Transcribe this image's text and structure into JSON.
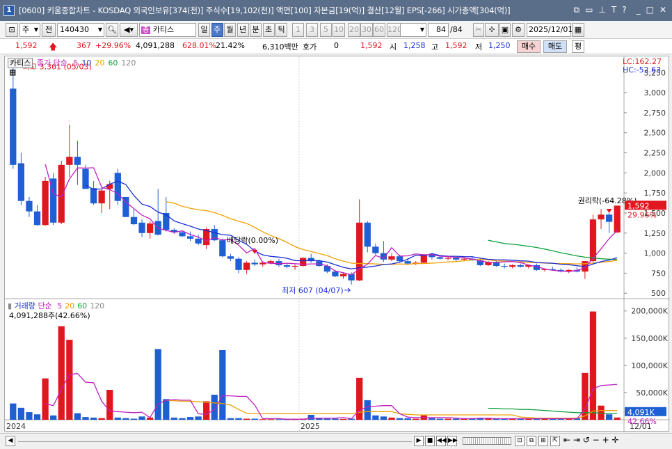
{
  "window": {
    "number": "1",
    "title": "[0600] 키움종합차트 - KOSDAQ 외국인보유[374(천)] 주식수[19,102(천)] 액면[100] 자본금[19(억)] 결산[12월] EPS[-266] 시가총액[304(억)]",
    "icons": [
      "restore-icon",
      "float-icon",
      "pin-icon",
      "text-icon",
      "help-icon",
      "minimize-icon",
      "maximize-icon",
      "close-icon"
    ]
  },
  "toolbar": {
    "period_label": "주",
    "prev_label": "전",
    "code": "140430",
    "stock_badge": "종",
    "stock_name": "카티스",
    "periods": [
      "일",
      "주",
      "월",
      "년",
      "분",
      "초",
      "틱"
    ],
    "active_period": "주",
    "intervals": [
      "1",
      "3",
      "5",
      "10",
      "20",
      "30",
      "60",
      "120"
    ],
    "count": "84",
    "count_total": "/84",
    "date": "2025/12/01"
  },
  "quote": {
    "price": "1,592",
    "change": "367",
    "change_pct": "+29.96%",
    "volume": "4,091,288",
    "volume_ratio": "628.01%",
    "turnover": "21.42%",
    "amount": "6,310백만",
    "hoga_label": "호가",
    "hoga_value": "0",
    "hoga_price": "1,592",
    "open_label": "시",
    "open": "1,258",
    "high_label": "고",
    "high": "1,592",
    "low_label": "저",
    "low": "1,250",
    "buy_label": "매수",
    "sell_label": "매도",
    "avg_label": "평"
  },
  "price_panel": {
    "stock_tag": "카티스",
    "legend_prefix": "종가 단순",
    "ma_periods": [
      "5",
      "10",
      "20",
      "60",
      "120"
    ],
    "ma_colors": [
      "#c020c0",
      "#1a2ed6",
      "#f0a000",
      "#10a040",
      "#888888"
    ],
    "lc_label": "LC:162.27",
    "hc_label": "HC:-52.63",
    "high_note": "최고 3,361 (05/03)",
    "low_note": "최저 607 (04/07)",
    "dividend_note": "배당락(0.00%)",
    "rights_note": "권리락(-64.28%)",
    "price_tag": "1,592",
    "pct_tag": "29.96%"
  },
  "volume_panel": {
    "title": "거래량",
    "legend_prefix": "단순",
    "ma_periods": [
      "5",
      "20",
      "60",
      "120"
    ],
    "ma_colors": [
      "#c020c0",
      "#f0a000",
      "#10a040",
      "#888888"
    ],
    "value_label": "4,091,288주(42.66%)",
    "vol_tag": "4,091K",
    "pct_tag": "42.66%"
  },
  "x_axis": {
    "labels": [
      "2024",
      "2025"
    ],
    "end_label": "12/01"
  },
  "chart_data": {
    "type": "candlestick",
    "price_axis": {
      "ticks": [
        "500",
        "750",
        "1,000",
        "1,250",
        "1,500",
        "1,750",
        "2,000",
        "2,250",
        "2,500",
        "2,750",
        "3,000",
        "3,250"
      ],
      "range": [
        450,
        3400
      ]
    },
    "volume_axis": {
      "ticks": [
        "50,000K",
        "100,000K",
        "150,000K",
        "200,000K"
      ],
      "range": [
        0,
        215000
      ]
    },
    "candles": [
      {
        "o": 3050,
        "h": 3361,
        "l": 2050,
        "c": 2100
      },
      {
        "o": 2120,
        "h": 2250,
        "l": 1600,
        "c": 1650
      },
      {
        "o": 1650,
        "h": 1700,
        "l": 1450,
        "c": 1520
      },
      {
        "o": 1520,
        "h": 1600,
        "l": 1340,
        "c": 1350
      },
      {
        "o": 1350,
        "h": 1950,
        "l": 1340,
        "c": 1900
      },
      {
        "o": 1930,
        "h": 2000,
        "l": 1350,
        "c": 1380
      },
      {
        "o": 1380,
        "h": 2150,
        "l": 1360,
        "c": 2100
      },
      {
        "o": 2100,
        "h": 2600,
        "l": 1950,
        "c": 2200
      },
      {
        "o": 2200,
        "h": 2400,
        "l": 1850,
        "c": 2100
      },
      {
        "o": 2050,
        "h": 2100,
        "l": 1800,
        "c": 1800
      },
      {
        "o": 1810,
        "h": 1900,
        "l": 1600,
        "c": 1620
      },
      {
        "o": 1620,
        "h": 1800,
        "l": 1500,
        "c": 1780
      },
      {
        "o": 1800,
        "h": 1900,
        "l": 1550,
        "c": 1860
      },
      {
        "o": 2000,
        "h": 2050,
        "l": 1600,
        "c": 1650
      },
      {
        "o": 1700,
        "h": 1700,
        "l": 1450,
        "c": 1450
      },
      {
        "o": 1450,
        "h": 1550,
        "l": 1350,
        "c": 1360
      },
      {
        "o": 1380,
        "h": 1420,
        "l": 1200,
        "c": 1250
      },
      {
        "o": 1250,
        "h": 1400,
        "l": 1180,
        "c": 1370
      },
      {
        "o": 1400,
        "h": 1800,
        "l": 1220,
        "c": 1230
      },
      {
        "o": 1500,
        "h": 1700,
        "l": 1270,
        "c": 1290
      },
      {
        "o": 1290,
        "h": 1310,
        "l": 1240,
        "c": 1260
      },
      {
        "o": 1260,
        "h": 1280,
        "l": 1200,
        "c": 1210
      },
      {
        "o": 1210,
        "h": 1270,
        "l": 1150,
        "c": 1180
      },
      {
        "o": 1180,
        "h": 1230,
        "l": 1100,
        "c": 1120
      },
      {
        "o": 1100,
        "h": 1320,
        "l": 1050,
        "c": 1300
      },
      {
        "o": 1300,
        "h": 1350,
        "l": 1150,
        "c": 1160
      },
      {
        "o": 1160,
        "h": 1180,
        "l": 950,
        "c": 960
      },
      {
        "o": 960,
        "h": 990,
        "l": 900,
        "c": 930
      },
      {
        "o": 930,
        "h": 950,
        "l": 750,
        "c": 790
      },
      {
        "o": 790,
        "h": 900,
        "l": 740,
        "c": 880
      },
      {
        "o": 880,
        "h": 920,
        "l": 840,
        "c": 860
      },
      {
        "o": 860,
        "h": 900,
        "l": 830,
        "c": 880
      },
      {
        "o": 880,
        "h": 920,
        "l": 860,
        "c": 900
      },
      {
        "o": 900,
        "h": 930,
        "l": 830,
        "c": 850
      },
      {
        "o": 850,
        "h": 870,
        "l": 810,
        "c": 830
      },
      {
        "o": 830,
        "h": 860,
        "l": 790,
        "c": 840
      },
      {
        "o": 840,
        "h": 950,
        "l": 830,
        "c": 940
      },
      {
        "o": 940,
        "h": 990,
        "l": 880,
        "c": 900
      },
      {
        "o": 900,
        "h": 920,
        "l": 830,
        "c": 840
      },
      {
        "o": 840,
        "h": 860,
        "l": 750,
        "c": 770
      },
      {
        "o": 770,
        "h": 790,
        "l": 700,
        "c": 710
      },
      {
        "o": 710,
        "h": 760,
        "l": 680,
        "c": 740
      },
      {
        "o": 740,
        "h": 760,
        "l": 607,
        "c": 660
      },
      {
        "o": 660,
        "h": 1670,
        "l": 650,
        "c": 1380
      },
      {
        "o": 1380,
        "h": 1400,
        "l": 1010,
        "c": 1080
      },
      {
        "o": 1080,
        "h": 1120,
        "l": 980,
        "c": 1000
      },
      {
        "o": 1000,
        "h": 1150,
        "l": 890,
        "c": 920
      },
      {
        "o": 920,
        "h": 1000,
        "l": 900,
        "c": 960
      },
      {
        "o": 960,
        "h": 980,
        "l": 890,
        "c": 900
      },
      {
        "o": 900,
        "h": 940,
        "l": 850,
        "c": 870
      },
      {
        "o": 870,
        "h": 900,
        "l": 850,
        "c": 880
      },
      {
        "o": 880,
        "h": 990,
        "l": 870,
        "c": 980
      },
      {
        "o": 980,
        "h": 1000,
        "l": 920,
        "c": 950
      },
      {
        "o": 950,
        "h": 970,
        "l": 920,
        "c": 930
      },
      {
        "o": 930,
        "h": 960,
        "l": 910,
        "c": 940
      },
      {
        "o": 940,
        "h": 960,
        "l": 900,
        "c": 920
      },
      {
        "o": 920,
        "h": 950,
        "l": 900,
        "c": 930
      },
      {
        "o": 930,
        "h": 950,
        "l": 900,
        "c": 910
      },
      {
        "o": 910,
        "h": 920,
        "l": 840,
        "c": 850
      },
      {
        "o": 850,
        "h": 900,
        "l": 840,
        "c": 890
      },
      {
        "o": 890,
        "h": 900,
        "l": 830,
        "c": 840
      },
      {
        "o": 840,
        "h": 870,
        "l": 810,
        "c": 830
      },
      {
        "o": 830,
        "h": 860,
        "l": 810,
        "c": 850
      },
      {
        "o": 850,
        "h": 870,
        "l": 820,
        "c": 830
      },
      {
        "o": 830,
        "h": 860,
        "l": 810,
        "c": 850
      },
      {
        "o": 850,
        "h": 870,
        "l": 780,
        "c": 790
      },
      {
        "o": 790,
        "h": 810,
        "l": 770,
        "c": 800
      },
      {
        "o": 800,
        "h": 830,
        "l": 780,
        "c": 790
      },
      {
        "o": 790,
        "h": 810,
        "l": 760,
        "c": 770
      },
      {
        "o": 770,
        "h": 800,
        "l": 750,
        "c": 790
      },
      {
        "o": 790,
        "h": 820,
        "l": 760,
        "c": 770
      },
      {
        "o": 770,
        "h": 900,
        "l": 680,
        "c": 900
      },
      {
        "o": 900,
        "h": 1480,
        "l": 880,
        "c": 1420
      },
      {
        "o": 1420,
        "h": 1550,
        "l": 1300,
        "c": 1480
      },
      {
        "o": 1480,
        "h": 1500,
        "l": 1250,
        "c": 1390
      },
      {
        "o": 1258,
        "h": 1592,
        "l": 1250,
        "c": 1592
      }
    ],
    "volumes": [
      30000,
      22000,
      14000,
      10000,
      76000,
      8000,
      172000,
      147000,
      12000,
      5000,
      4000,
      3000,
      55000,
      4000,
      3000,
      2000,
      6000,
      4000,
      130000,
      38000,
      4000,
      3000,
      5000,
      6000,
      34000,
      46000,
      128000,
      3000,
      3000,
      2000,
      2000,
      1000,
      1000,
      1000,
      1000,
      1000,
      2000,
      9000,
      3000,
      2000,
      2000,
      1500,
      2000,
      77000,
      36000,
      8000,
      6000,
      4000,
      3000,
      3000,
      2000,
      8000,
      3000,
      2000,
      2000,
      2000,
      2000,
      3000,
      3000,
      2000,
      2000,
      2000,
      2000,
      2000,
      2000,
      2000,
      2000,
      2000,
      2000,
      2000,
      3000,
      86000,
      199000,
      26000,
      10000,
      4091
    ],
    "ma5": [
      null,
      null,
      null,
      null,
      2106,
      1740,
      1700,
      1923,
      2062,
      2060,
      2064,
      1820,
      1792,
      1742,
      1636,
      1554,
      1473,
      1428,
      1310,
      1284,
      1259,
      1278,
      1233,
      1199,
      1154,
      1194,
      1164,
      1168,
      1100,
      1003,
      1057,
      882,
      873,
      868,
      874,
      868,
      861,
      866,
      866,
      843,
      777,
      755,
      729,
      804,
      863,
      971,
      934,
      1068,
      963,
      966,
      990,
      979,
      983,
      962,
      957,
      947,
      941,
      926,
      904,
      885,
      884,
      892,
      895,
      881,
      852,
      832,
      803,
      785,
      776,
      770,
      784,
      820,
      934,
      1055,
      1180,
      1282
    ],
    "ma10": [
      null,
      null,
      null,
      null,
      null,
      null,
      null,
      null,
      null,
      1845,
      1796,
      1800,
      1858,
      1898,
      1855,
      1717,
      1611,
      1581,
      1510,
      1477,
      1402,
      1367,
      1336,
      1300,
      1280,
      1255,
      1230,
      1224,
      1160,
      1109,
      1027,
      978,
      959,
      951,
      936,
      907,
      905,
      910,
      906,
      888,
      856,
      823,
      803,
      818,
      826,
      840,
      858,
      866,
      887,
      925,
      975,
      965,
      993,
      971,
      962,
      961,
      957,
      955,
      938,
      923,
      918,
      916,
      912,
      904,
      900,
      882,
      879,
      874,
      861,
      856,
      843,
      832,
      864,
      895,
      913,
      944
    ],
    "ma20": [
      null,
      null,
      null,
      null,
      null,
      null,
      null,
      null,
      null,
      null,
      null,
      null,
      null,
      null,
      null,
      null,
      null,
      null,
      null,
      1640,
      1623,
      1583,
      1560,
      1540,
      1530,
      1505,
      1470,
      1430,
      1397,
      1370,
      1320,
      1265,
      1220,
      1180,
      1135,
      1080,
      1045,
      1020,
      995,
      970,
      930,
      900,
      875,
      870,
      870,
      865,
      860,
      860,
      865,
      860,
      870,
      870,
      875,
      880,
      890,
      895,
      905,
      915,
      925,
      915,
      905,
      900,
      895,
      890,
      885,
      880,
      875,
      872,
      870,
      868,
      866,
      868,
      875,
      885,
      895,
      912
    ],
    "ma60": [
      null,
      null,
      null,
      null,
      null,
      null,
      null,
      null,
      null,
      null,
      null,
      null,
      null,
      null,
      null,
      null,
      null,
      null,
      null,
      null,
      null,
      null,
      null,
      null,
      null,
      null,
      null,
      null,
      null,
      null,
      null,
      null,
      null,
      null,
      null,
      null,
      null,
      null,
      null,
      null,
      null,
      null,
      null,
      null,
      null,
      null,
      null,
      null,
      null,
      null,
      null,
      null,
      null,
      null,
      null,
      null,
      null,
      null,
      null,
      1160,
      1140,
      1120,
      1110,
      1100,
      1085,
      1070,
      1050,
      1030,
      1005,
      985,
      965,
      950,
      940,
      930,
      925,
      920
    ],
    "vol_ma5": [
      null,
      null,
      null,
      null,
      30000,
      26000,
      56000,
      83000,
      85000,
      69000,
      68000,
      34000,
      16000,
      15000,
      14000,
      13000,
      14000,
      4000,
      29000,
      36000,
      37000,
      36000,
      36000,
      11000,
      10000,
      19000,
      44000,
      44000,
      43000,
      43000,
      27000,
      2000,
      2000,
      2000,
      1000,
      1000,
      1000,
      3000,
      3000,
      3000,
      3000,
      4000,
      2000,
      17000,
      24000,
      25000,
      26000,
      26000,
      11000,
      5000,
      4000,
      4000,
      4000,
      4000,
      4000,
      3000,
      2000,
      2000,
      3000,
      3000,
      2000,
      2000,
      2000,
      2000,
      2000,
      2000,
      2000,
      2000,
      2000,
      2000,
      2000,
      19000,
      57000,
      63000,
      64000,
      65000
    ],
    "vol_ma20": [
      null,
      null,
      null,
      null,
      null,
      null,
      null,
      null,
      null,
      null,
      null,
      null,
      null,
      null,
      null,
      null,
      null,
      null,
      null,
      36000,
      35000,
      34000,
      34000,
      33000,
      32000,
      31000,
      30000,
      27000,
      19000,
      12000,
      11000,
      11000,
      11000,
      11000,
      11000,
      11000,
      11000,
      11000,
      11000,
      11000,
      11000,
      11000,
      11000,
      14000,
      15000,
      15000,
      15000,
      15000,
      11000,
      10000,
      9000,
      9000,
      9000,
      9000,
      9000,
      9000,
      9000,
      9000,
      9000,
      9000,
      9000,
      9000,
      9000,
      5000,
      4000,
      3000,
      3000,
      3000,
      3000,
      3000,
      3000,
      7000,
      16000,
      17000,
      17000,
      17000
    ],
    "vol_ma60": [
      null,
      null,
      null,
      null,
      null,
      null,
      null,
      null,
      null,
      null,
      null,
      null,
      null,
      null,
      null,
      null,
      null,
      null,
      null,
      null,
      null,
      null,
      null,
      null,
      null,
      null,
      null,
      null,
      null,
      null,
      null,
      null,
      null,
      null,
      null,
      null,
      null,
      null,
      null,
      null,
      null,
      null,
      null,
      null,
      null,
      null,
      null,
      null,
      null,
      null,
      null,
      null,
      null,
      null,
      null,
      null,
      null,
      null,
      null,
      21000,
      21000,
      20000,
      20000,
      19000,
      19000,
      18000,
      17000,
      16000,
      15000,
      14000,
      13000,
      13000,
      13000,
      12000,
      12000,
      12000
    ],
    "markers": {
      "high_index": 0,
      "low_index": 42,
      "dividend_index": 30,
      "rights_index": 74
    }
  }
}
